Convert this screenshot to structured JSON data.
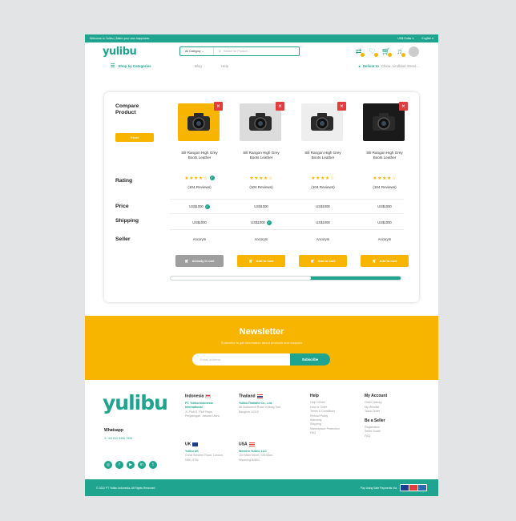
{
  "topbar": {
    "welcome": "Welcome to Yulibu | Make your own happiness",
    "currency": "US$ Dollar ▾",
    "language": "English ▾"
  },
  "header": {
    "logo": "yulibu",
    "category": "All Category ⌄",
    "search_placeholder": "Search for Product..."
  },
  "nav": {
    "categories": "Shop by Categories",
    "blog": "Blog",
    "help": "Help",
    "deliver_label": "Deliver to",
    "deliver_value": "China, Lindblad Street..."
  },
  "compare": {
    "title_line1": "Compare",
    "title_line2": "Product",
    "reset": "Reset",
    "labels": {
      "rating": "Rating",
      "price": "Price",
      "shipping": "Shipping",
      "seller": "Seller"
    },
    "products": [
      {
        "name_line1": "Slil Rangon High Grey",
        "name_line2": "Boots Leather",
        "stars": "★★★★☆",
        "reviews": "(104 Reviews)",
        "price": "US$1000",
        "shipping": "US$1000",
        "seller": "Ancorym",
        "button": "Already in cart",
        "image_bg": "#f7b500"
      },
      {
        "name_line1": "Slil Rangon High Grey",
        "name_line2": "Boots Leather",
        "stars": "★★★★☆",
        "reviews": "(104 Reviews)",
        "price": "US$1000",
        "shipping": "US$1000",
        "seller": "Ancorym",
        "button": "Add to Cart",
        "image_bg": "#dcdcdc"
      },
      {
        "name_line1": "Slil Rangon High Grey",
        "name_line2": "Boots Leather",
        "stars": "★★★★☆",
        "reviews": "(104 Reviews)",
        "price": "US$1000",
        "shipping": "US$1000",
        "seller": "Ancorym",
        "button": "Add to Cart",
        "image_bg": "#eeeeee"
      },
      {
        "name_line1": "Slil Rangon High Grey",
        "name_line2": "Boots Leather",
        "stars": "★★★★☆",
        "reviews": "(104 Reviews)",
        "price": "US$1000",
        "shipping": "US$1000",
        "seller": "Ancorym",
        "button": "Add to Cart",
        "image_bg": "#1a1a1a"
      }
    ]
  },
  "newsletter": {
    "title": "Newsletter",
    "subtitle": "Subscribe to get information about products and coupons",
    "placeholder": "Email address",
    "button": "Subscribe"
  },
  "footer": {
    "logo": "yulibu",
    "whatsapp": "Whatsapp",
    "phone": "+62 812 3456 7890",
    "indonesia": {
      "country": "Indonesia",
      "company": "PT. Yulibu Indonesia International",
      "address": "Jl. Pluit Jl. Pluit Raya, Penjaringan, Jakarta Utara"
    },
    "thailand": {
      "country": "Thailand",
      "company": "Yulibu Thailand Co., Ltd.",
      "address": "88 Sukhumvit Road, Khlong Toei, Bangkok 10110"
    },
    "uk": {
      "country": "UK",
      "company": "Yulibu UK",
      "address": "Great Western Road, London, NW1 5TW"
    },
    "usa": {
      "country": "USA",
      "company": "Western Yulibu, LLC",
      "address": "100 Main Street, Sheridan, Wyoming 82801"
    },
    "help": {
      "title": "Help",
      "items": [
        "Help Center",
        "How to Order",
        "Terms & Conditions",
        "Refund Policy",
        "Warranty",
        "Shipping",
        "Marketplace Protection",
        "FAQ"
      ]
    },
    "account": {
      "title": "My Account",
      "items": [
        "Order History",
        "My Wishlist",
        "Track Order"
      ]
    },
    "seller": {
      "title": "Be a Seller",
      "items": [
        "Registration",
        "Seller Guide",
        "FAQ"
      ]
    },
    "copyright": "© 2022 PT Yulibu Indonesia. All Rights Reserved",
    "payment_label": "Pay Using Safe Payments Via"
  },
  "colors": {
    "accent": "#1fa58f",
    "yellow": "#f7b500",
    "danger": "#e23d3d"
  }
}
